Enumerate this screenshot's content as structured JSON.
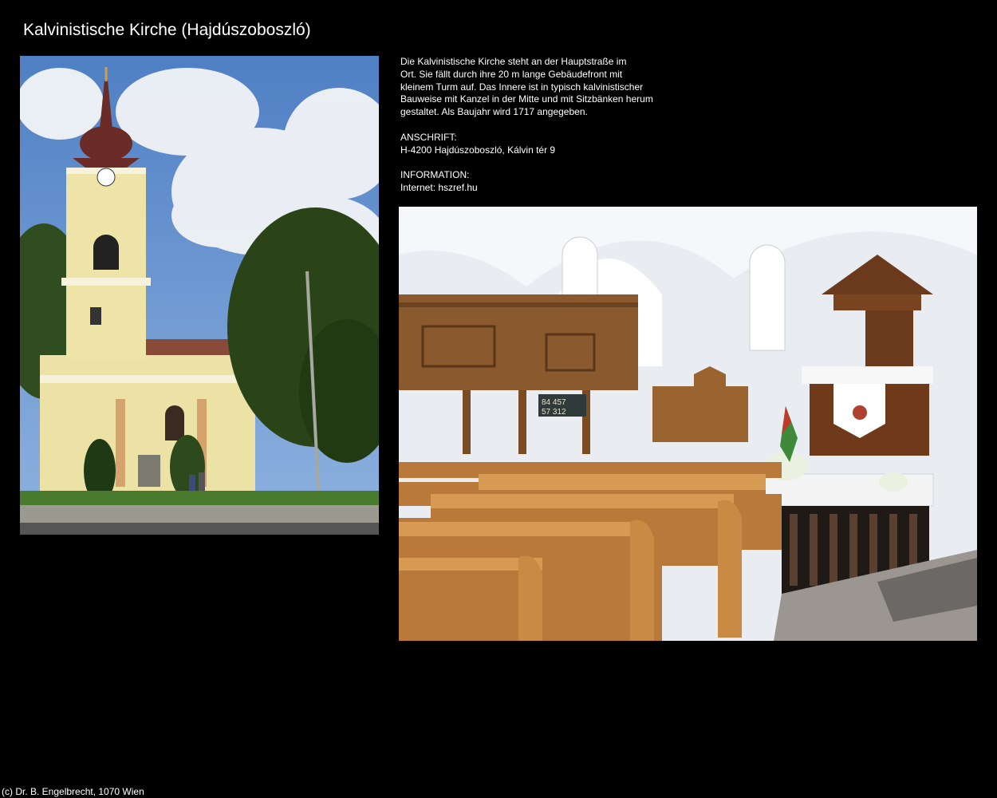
{
  "page": {
    "title": "Kalvinistische Kirche (Hajdúszoboszló)",
    "footer": "(c) Dr. B. Engelbrecht, 1070 Wien"
  },
  "description": [
    "Die Kalvinistische Kirche steht an der Hauptstraße im",
    "Ort. Sie fällt durch ihre 20 m lange Gebäudefront mit",
    "kleinem Turm auf. Das Innere ist in typisch kalvinistischer",
    "Bauweise mit Kanzel in der Mitte und mit Sitzbänken herum",
    "gestaltet. Als Baujahr wird 1717 angegeben."
  ],
  "address": {
    "label": "ANSCHRIFT:",
    "value": "H-4200 Hajdúszoboszló, Kálvin tér 9"
  },
  "information": {
    "label": "INFORMATION:",
    "value": "Internet: hszref.hu"
  },
  "hymn_board": {
    "row1": "84 457",
    "row2": "57 312"
  }
}
